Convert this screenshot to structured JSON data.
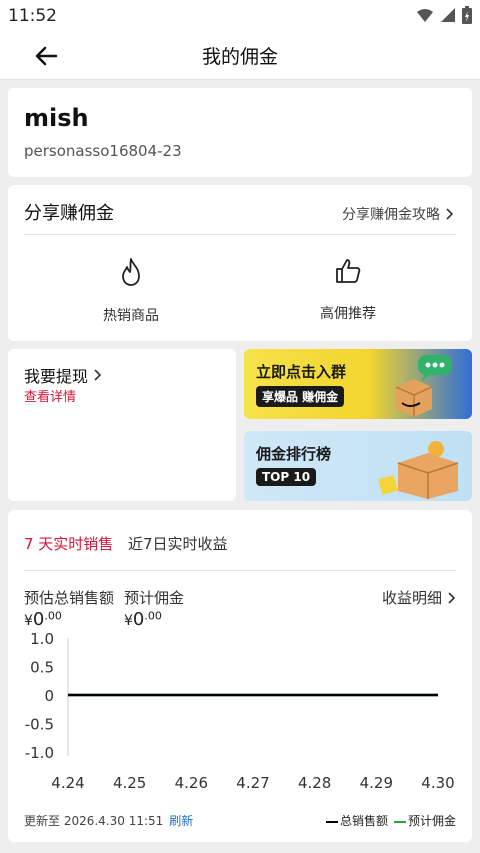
{
  "status_bar": {
    "time": "11:52"
  },
  "header": {
    "title": "我的佣金"
  },
  "profile": {
    "name": "mish",
    "id": "personasso16804-23"
  },
  "share": {
    "title": "分享赚佣金",
    "guide_label": "分享赚佣金攻略",
    "items": [
      {
        "label": "热销商品",
        "icon": "flame-icon"
      },
      {
        "label": "高佣推荐",
        "icon": "thumbs-up-icon"
      }
    ]
  },
  "withdraw": {
    "title": "我要提现",
    "detail": "查看详情"
  },
  "banners": [
    {
      "title": "立即点击入群",
      "pill": "享爆品 赚佣金"
    },
    {
      "title": "佣金排行榜",
      "pill": "TOP 10"
    }
  ],
  "sales": {
    "tab_active": "7 天实时销售",
    "tab_inactive": "近7日实时收益",
    "metric1_label": "预估总销售额",
    "metric2_label": "预计佣金",
    "currency": "¥",
    "metric1_int": "0",
    "metric1_dec": ".00",
    "metric2_int": "0",
    "metric2_dec": ".00",
    "detail_label": "收益明细",
    "updated": "更新至 2026.4.30 11:51",
    "refresh": "刷新",
    "legend": [
      "总销售额",
      "预计佣金"
    ]
  },
  "colors": {
    "accent": "#d6173d",
    "link": "#1a73c9",
    "legend_total": "#000000",
    "legend_commission": "#2e9e3e"
  },
  "chart_data": {
    "type": "line",
    "x": [
      "4.24",
      "4.25",
      "4.26",
      "4.27",
      "4.28",
      "4.29",
      "4.30"
    ],
    "series": [
      {
        "name": "总销售额",
        "values": [
          0,
          0,
          0,
          0,
          0,
          0,
          0
        ]
      },
      {
        "name": "预计佣金",
        "values": [
          0,
          0,
          0,
          0,
          0,
          0,
          0
        ]
      }
    ],
    "yticks": [
      "1.0",
      "0.5",
      "0",
      "-0.5",
      "-1.0"
    ],
    "ylim": [
      -1.0,
      1.0
    ],
    "grid": false,
    "legend": "bottom-right"
  }
}
